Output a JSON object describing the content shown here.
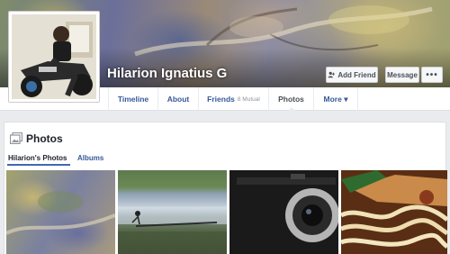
{
  "profile": {
    "name": "Hilarion Ignatius G"
  },
  "cover_buttons": {
    "add_friend": "Add Friend",
    "message": "Message",
    "more": "•••"
  },
  "nav": {
    "items": [
      {
        "label": "Timeline"
      },
      {
        "label": "About"
      },
      {
        "label": "Friends",
        "sub": "8 Mutual"
      },
      {
        "label": "Photos"
      },
      {
        "label": "More ▾"
      }
    ]
  },
  "photos_panel": {
    "title": "Photos",
    "tabs": [
      {
        "label": "Hilarion's Photos"
      },
      {
        "label": "Albums"
      }
    ]
  },
  "colors": {
    "link_blue": "#365899",
    "active_tab_underline": "#4267b2",
    "page_background": "#e9ebee"
  },
  "icons": [
    "add-friend-icon",
    "photos-icon"
  ]
}
